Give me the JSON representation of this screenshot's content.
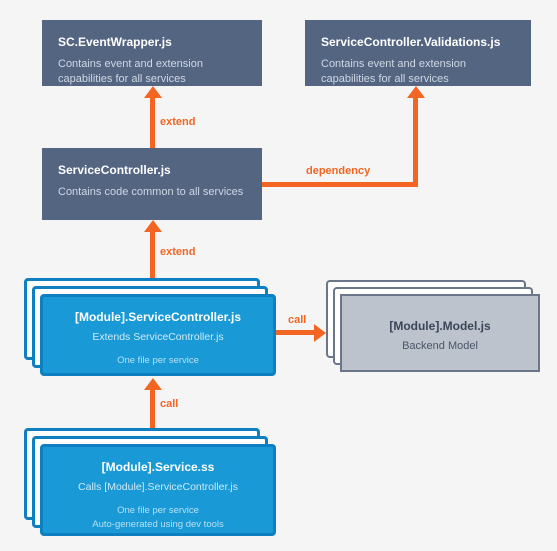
{
  "boxes": {
    "eventWrapper": {
      "title": "SC.EventWrapper.js",
      "desc": "Contains event and extension capabilities  for all services"
    },
    "validations": {
      "title": "ServiceController.Validations.js",
      "desc": "Contains event and extension capabilities  for all services"
    },
    "serviceController": {
      "title": "ServiceController.js",
      "desc": "Contains code common to all services"
    },
    "moduleSC": {
      "title": "[Module].ServiceController.js",
      "sub": "Extends ServiceController.js",
      "note": "One file per service"
    },
    "model": {
      "title": "[Module].Model.js",
      "sub": "Backend Model"
    },
    "serviceSS": {
      "title": "[Module].Service.ss",
      "sub": "Calls [Module].ServiceController.js",
      "note": "One file per service\nAuto-generated using dev tools"
    }
  },
  "labels": {
    "extend1": "extend",
    "extend2": "extend",
    "dependency": "dependency",
    "call1": "call",
    "call2": "call"
  }
}
